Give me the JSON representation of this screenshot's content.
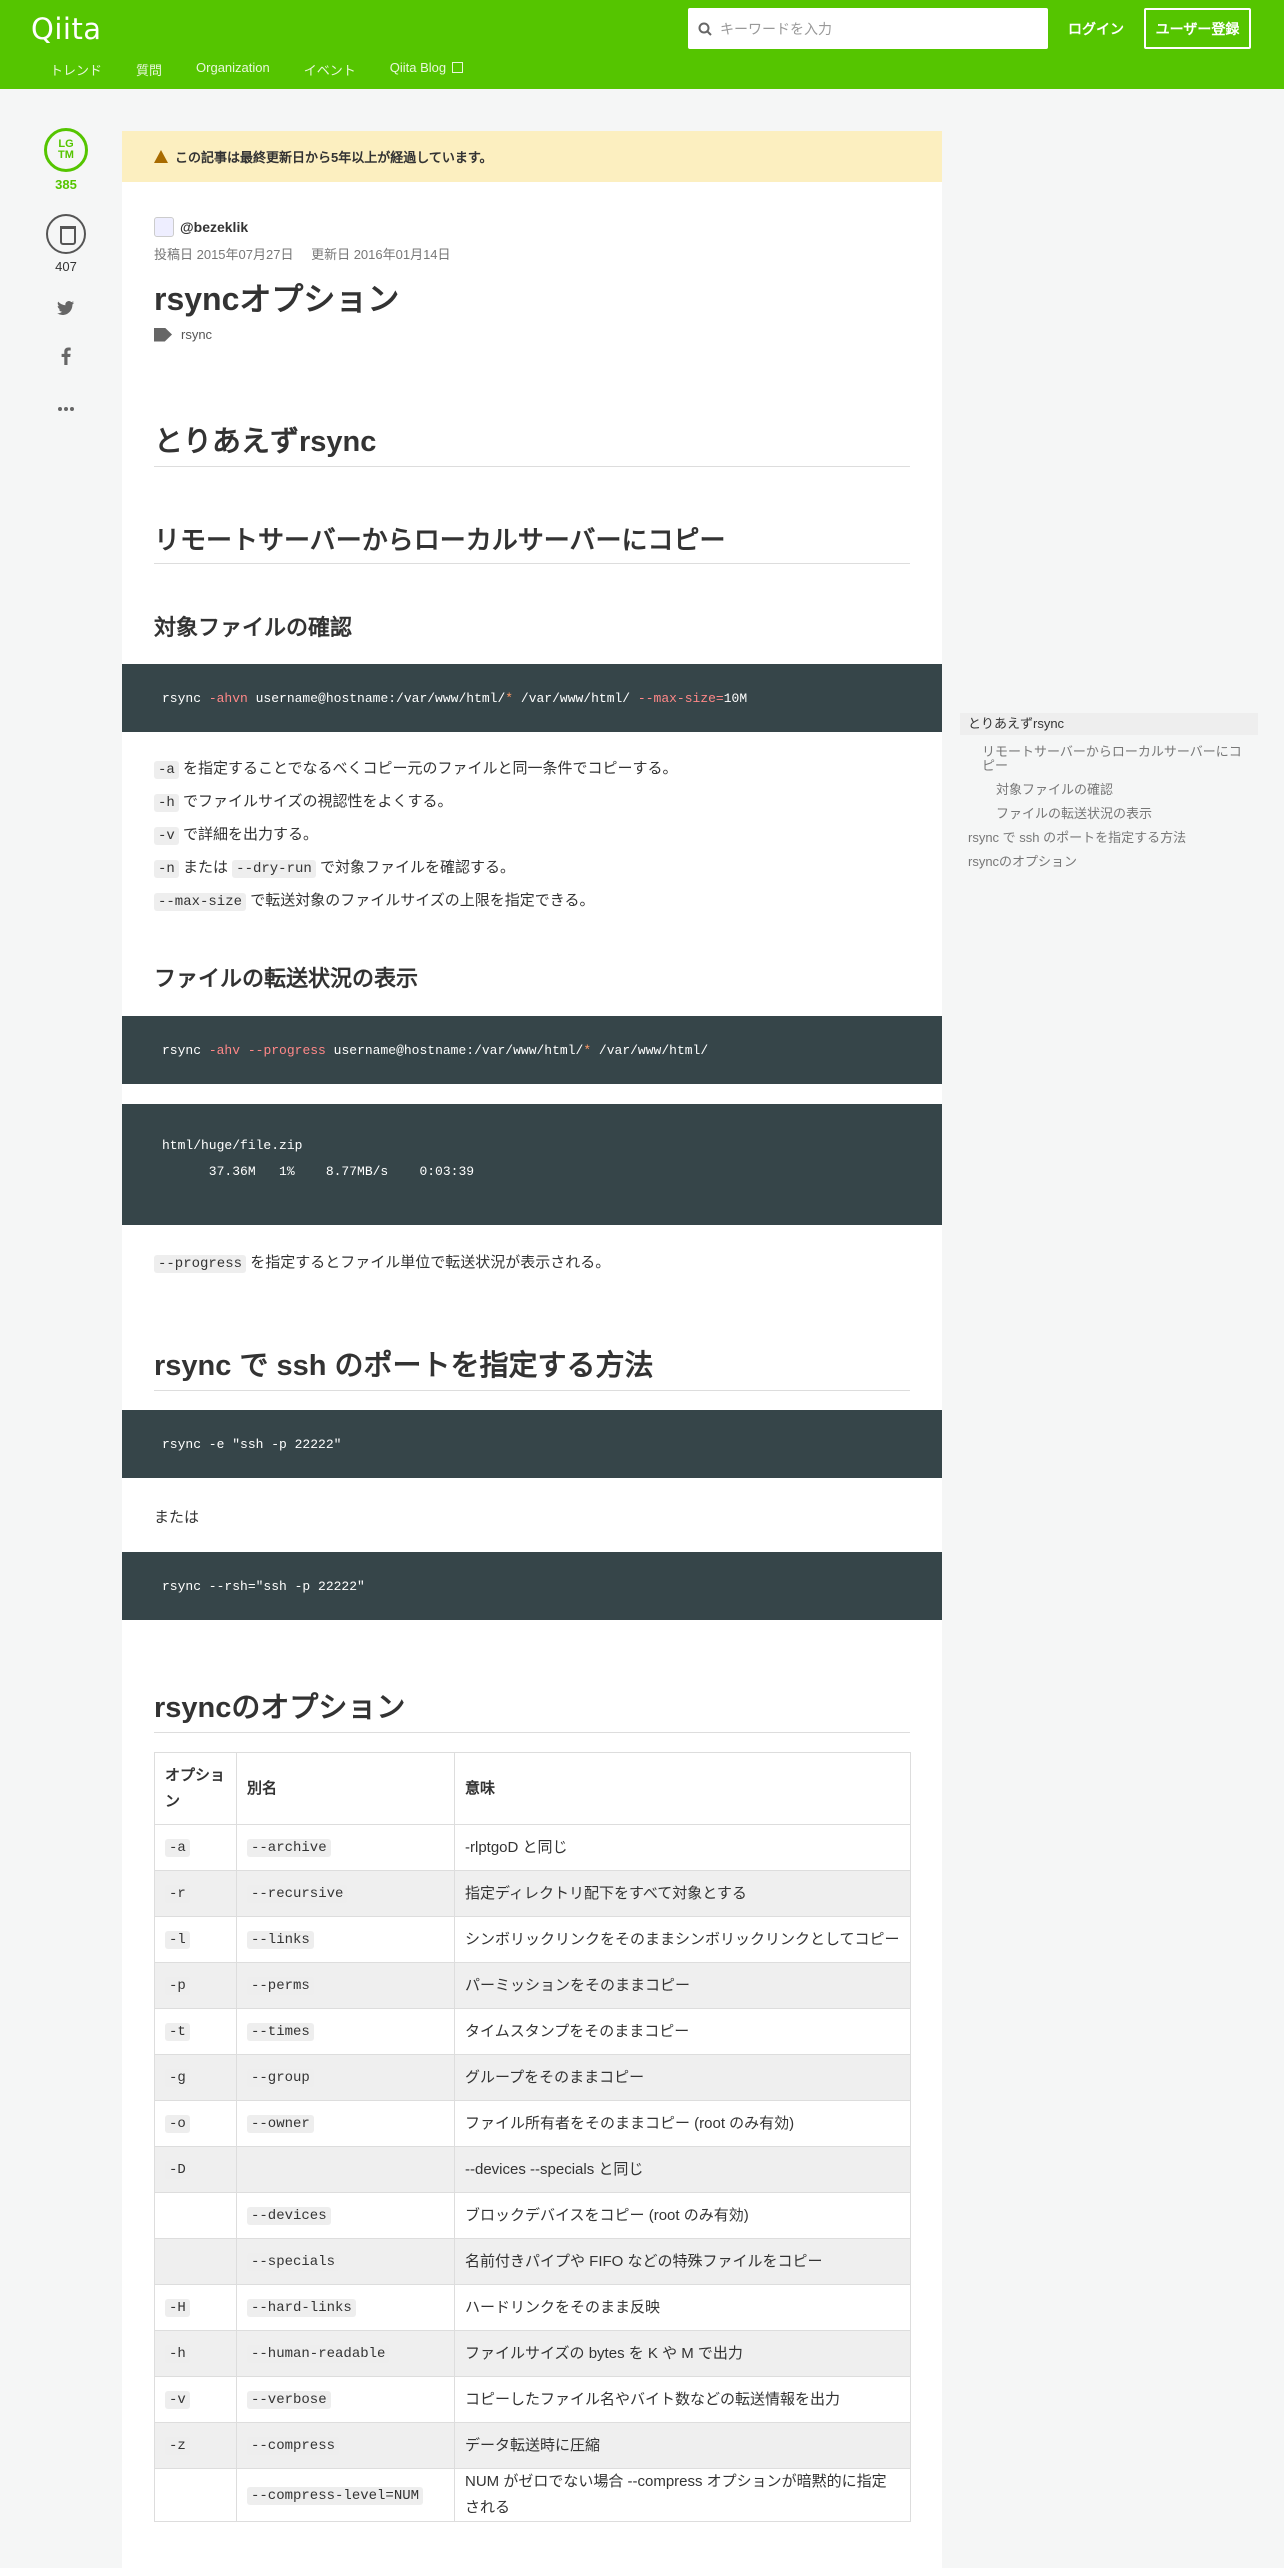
{
  "header": {
    "logo": "Qiita",
    "search_placeholder": "キーワードを入力",
    "login": "ログイン",
    "signup": "ユーザー登録",
    "nav": [
      "トレンド",
      "質問",
      "Organization",
      "イベント",
      "Qiita Blog"
    ]
  },
  "sidebar": {
    "lgtm_label": "LG\nTM",
    "lgtm_count": "385",
    "stock_count": "407"
  },
  "article": {
    "warning": "この記事は最終更新日から5年以上が経過しています。",
    "author": "@bezeklik",
    "posted": "投稿日 2015年07月27日",
    "updated": "更新日 2016年01月14日",
    "title": "rsyncオプション",
    "tag": "rsync",
    "h_toriaezu": "とりあえずrsync",
    "h_remote": "リモートサーバーからローカルサーバーにコピー",
    "h_check": "対象ファイルの確認",
    "code1": {
      "a": "rsync ",
      "b": "-ahvn",
      "c": " username@hostname:/var/www/html/",
      "d": "*",
      "e": " /var/www/html/ ",
      "f": "--max-size=",
      "g": "10M"
    },
    "list1": [
      {
        "code": "-a",
        "text": "を指定することでなるべくコピー元のファイルと同一条件でコピーする。"
      },
      {
        "code": "-h",
        "text": "でファイルサイズの視認性をよくする。"
      },
      {
        "code": "-v",
        "text": "で詳細を出力する。"
      },
      {
        "code": "-n",
        "mid": "または",
        "code2": "--dry-run",
        "text": "で対象ファイルを確認する。"
      },
      {
        "code": "--max-size",
        "text": "で転送対象のファイルサイズの上限を指定できる。"
      }
    ],
    "h_progress": "ファイルの転送状況の表示",
    "code2": {
      "a": "rsync ",
      "b": "-ahv",
      "c": " ",
      "d": "--progress",
      "e": " username@hostname:/var/www/html/",
      "f": "*",
      "g": " /var/www/html/"
    },
    "code3_line1": "html/huge/file.zip",
    "code3_line2": "      37.36M   1%    8.77MB/s    0:03:39",
    "progress_code": "--progress",
    "progress_text": "を指定するとファイル単位で転送状況が表示される。",
    "h_ssh": "rsync で ssh のポートを指定する方法",
    "code4": "rsync -e \"ssh -p 22222\"",
    "or_text": "または",
    "code5": "rsync --rsh=\"ssh -p 22222\"",
    "h_options": "rsyncのオプション",
    "table_headers": [
      "オプション",
      "別名",
      "意味"
    ],
    "table_rows": [
      [
        "-a",
        "--archive",
        "-rlptgoD と同じ"
      ],
      [
        "-r",
        "--recursive",
        "指定ディレクトリ配下をすべて対象とする"
      ],
      [
        "-l",
        "--links",
        "シンボリックリンクをそのままシンボリックリンクとしてコピー"
      ],
      [
        "-p",
        "--perms",
        "パーミッションをそのままコピー"
      ],
      [
        "-t",
        "--times",
        "タイムスタンプをそのままコピー"
      ],
      [
        "-g",
        "--group",
        "グループをそのままコピー"
      ],
      [
        "-o",
        "--owner",
        "ファイル所有者をそのままコピー (root のみ有効)"
      ],
      [
        "-D",
        "",
        "--devices --specials と同じ"
      ],
      [
        "",
        "--devices",
        "ブロックデバイスをコピー (root のみ有効)"
      ],
      [
        "",
        "--specials",
        "名前付きパイプや FIFO などの特殊ファイルをコピー"
      ],
      [
        "-H",
        "--hard-links",
        "ハードリンクをそのまま反映"
      ],
      [
        "-h",
        "--human-readable",
        "ファイルサイズの bytes を K や M で出力"
      ],
      [
        "-v",
        "--verbose",
        "コピーしたファイル名やバイト数などの転送情報を出力"
      ],
      [
        "-z",
        "--compress",
        "データ転送時に圧縮"
      ],
      [
        "",
        "--compress-level=NUM",
        "NUM がゼロでない場合 --compress オプションが暗黙的に指定される"
      ]
    ]
  },
  "toc": [
    "とりあえずrsync",
    "リモートサーバーからローカルサーバーにコピー",
    "対象ファイルの確認",
    "ファイルの転送状況の表示",
    "rsync で ssh のポートを指定する方法",
    "rsyncのオプション"
  ]
}
